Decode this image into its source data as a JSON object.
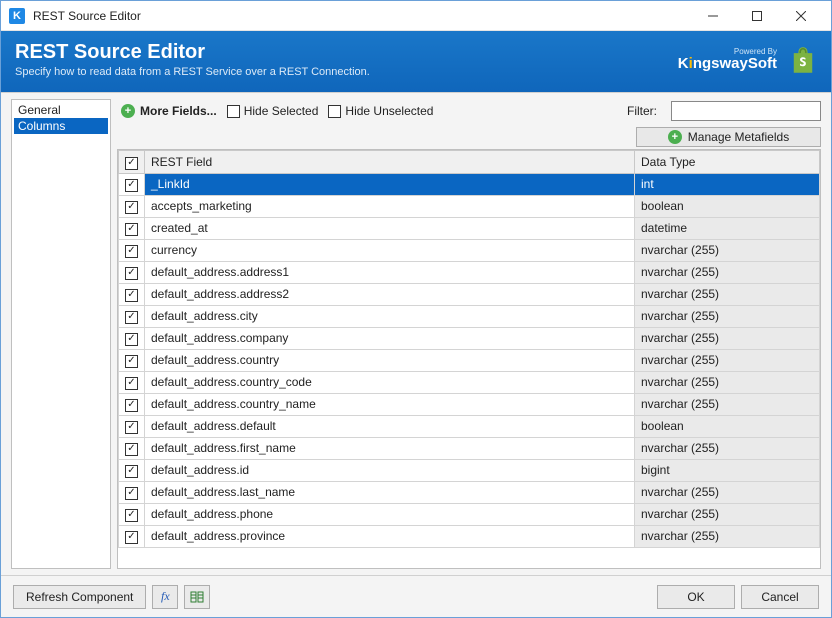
{
  "window": {
    "title": "REST Source Editor"
  },
  "header": {
    "title": "REST Source Editor",
    "subtitle": "Specify how to read data from a REST Service over a REST Connection.",
    "powered_by": "Powered By",
    "brand_a": "K",
    "brand_b": "ngswaySoft"
  },
  "sidebar": {
    "items": [
      {
        "label": "General",
        "active": false
      },
      {
        "label": "Columns",
        "active": true
      }
    ]
  },
  "toolbar": {
    "more_fields": "More Fields...",
    "hide_selected": "Hide Selected",
    "hide_unselected": "Hide Unselected",
    "filter_label": "Filter:",
    "filter_value": "",
    "manage_metafields": "Manage Metafields"
  },
  "grid": {
    "col_field": "REST Field",
    "col_type": "Data Type",
    "rows": [
      {
        "checked": true,
        "field": "_LinkId",
        "type": "int",
        "selected": true
      },
      {
        "checked": true,
        "field": "accepts_marketing",
        "type": "boolean"
      },
      {
        "checked": true,
        "field": "created_at",
        "type": "datetime"
      },
      {
        "checked": true,
        "field": "currency",
        "type": "nvarchar (255)"
      },
      {
        "checked": true,
        "field": "default_address.address1",
        "type": "nvarchar (255)"
      },
      {
        "checked": true,
        "field": "default_address.address2",
        "type": "nvarchar (255)"
      },
      {
        "checked": true,
        "field": "default_address.city",
        "type": "nvarchar (255)"
      },
      {
        "checked": true,
        "field": "default_address.company",
        "type": "nvarchar (255)"
      },
      {
        "checked": true,
        "field": "default_address.country",
        "type": "nvarchar (255)"
      },
      {
        "checked": true,
        "field": "default_address.country_code",
        "type": "nvarchar (255)"
      },
      {
        "checked": true,
        "field": "default_address.country_name",
        "type": "nvarchar (255)"
      },
      {
        "checked": true,
        "field": "default_address.default",
        "type": "boolean"
      },
      {
        "checked": true,
        "field": "default_address.first_name",
        "type": "nvarchar (255)"
      },
      {
        "checked": true,
        "field": "default_address.id",
        "type": "bigint"
      },
      {
        "checked": true,
        "field": "default_address.last_name",
        "type": "nvarchar (255)"
      },
      {
        "checked": true,
        "field": "default_address.phone",
        "type": "nvarchar (255)"
      },
      {
        "checked": true,
        "field": "default_address.province",
        "type": "nvarchar (255)"
      }
    ]
  },
  "footer": {
    "refresh": "Refresh Component",
    "ok": "OK",
    "cancel": "Cancel"
  }
}
